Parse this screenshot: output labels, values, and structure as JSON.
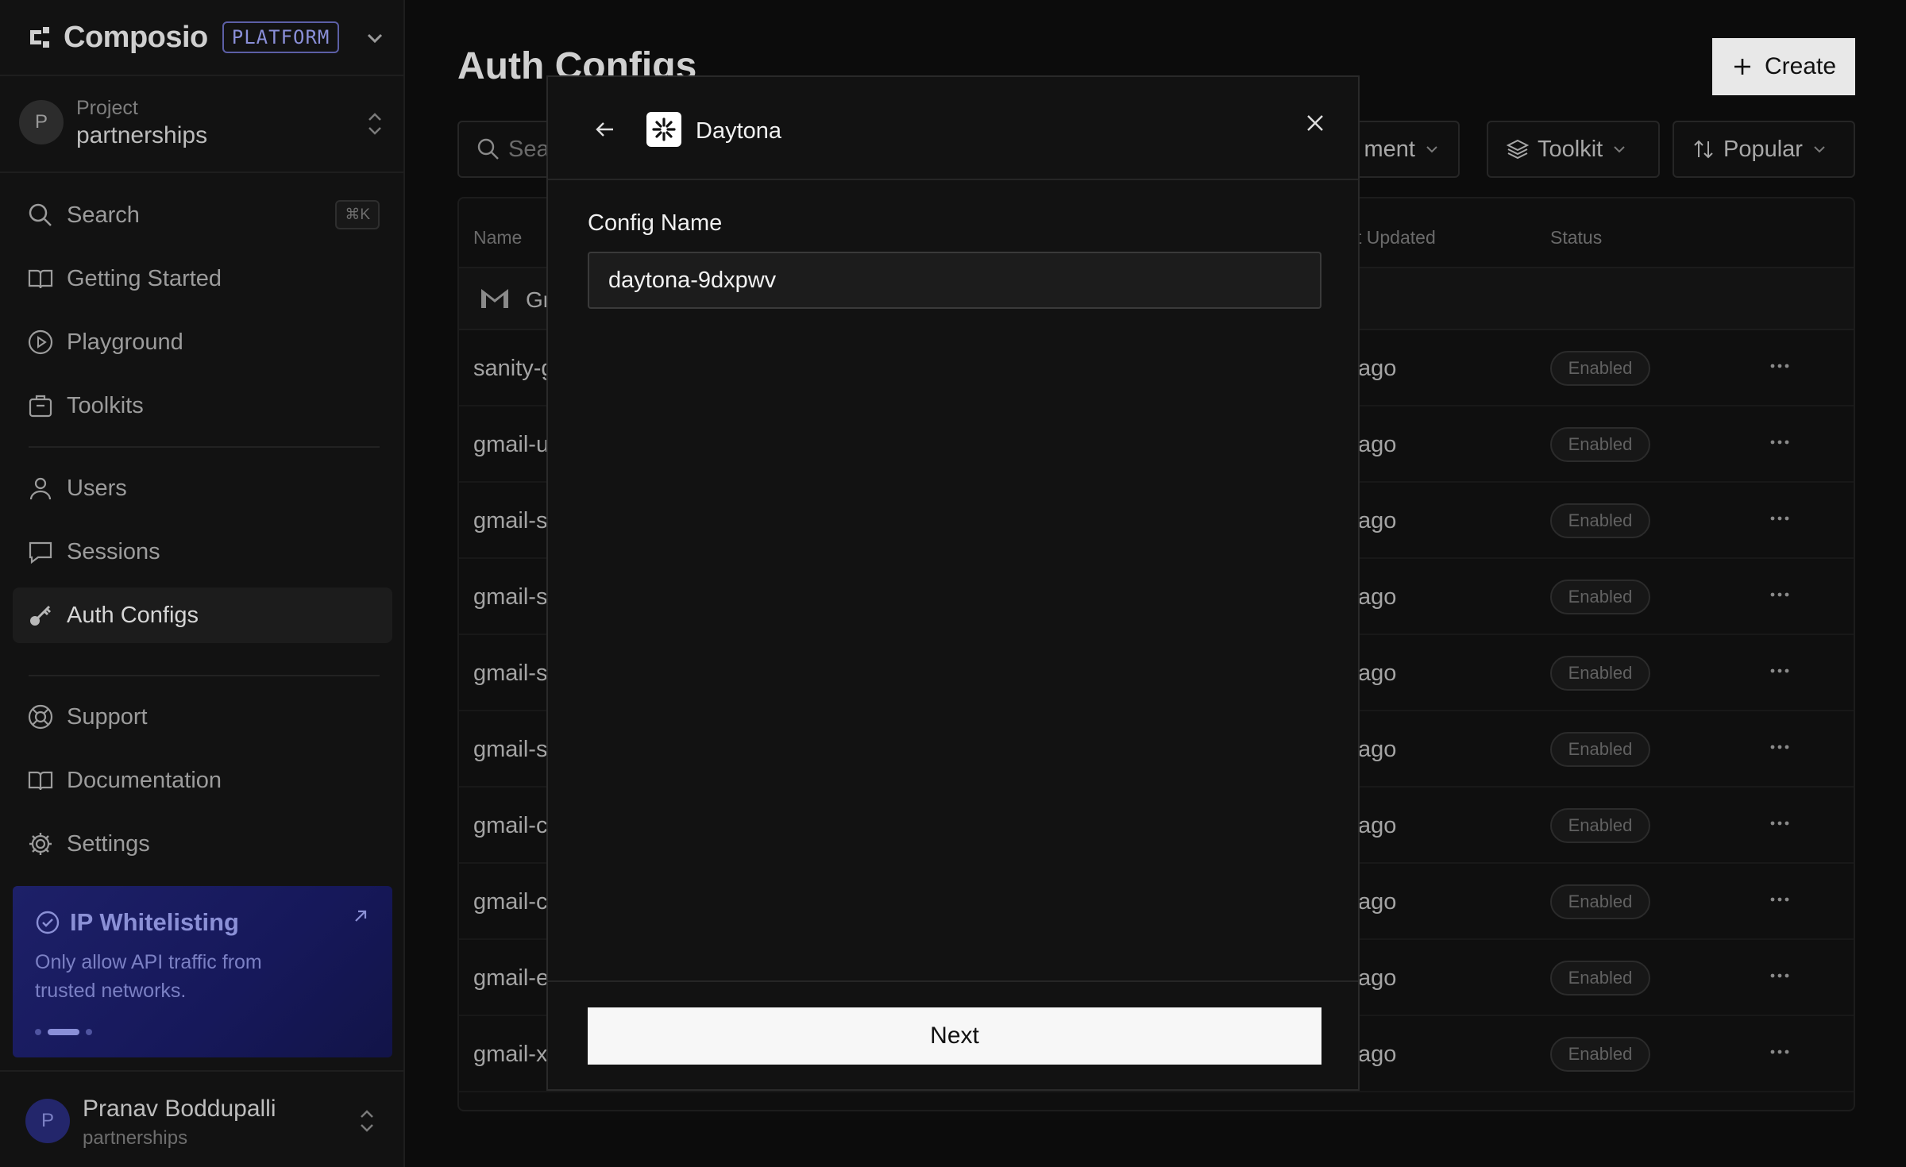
{
  "brand": {
    "name": "Composio",
    "badge": "PLATFORM"
  },
  "project": {
    "label": "Project",
    "name": "partnerships"
  },
  "nav": {
    "search": {
      "label": "Search",
      "shortcut": "⌘K"
    },
    "items": [
      {
        "label": "Getting Started",
        "icon": "book-open-icon"
      },
      {
        "label": "Playground",
        "icon": "play-circle-icon"
      },
      {
        "label": "Toolkits",
        "icon": "toolkit-icon"
      }
    ],
    "items2": [
      {
        "label": "Users",
        "icon": "user-icon"
      },
      {
        "label": "Sessions",
        "icon": "chat-icon"
      },
      {
        "label": "Auth Configs",
        "icon": "key-icon",
        "active": true
      }
    ],
    "bottom": [
      {
        "label": "Support",
        "icon": "lifebuoy-icon"
      },
      {
        "label": "Documentation",
        "icon": "book-icon"
      },
      {
        "label": "Settings",
        "icon": "gear-icon"
      }
    ]
  },
  "promo": {
    "title": "IP Whitelisting",
    "description": "Only allow API traffic from trusted networks."
  },
  "user": {
    "name": "Pranav Boddupalli",
    "project": "partnerships",
    "initial": "P"
  },
  "page": {
    "title": "Auth Configs",
    "create_label": "Create",
    "search_placeholder": "Sea",
    "filters": {
      "environment": "ment",
      "toolkit": "Toolkit",
      "sort": "Popular"
    },
    "columns": {
      "name": "Name",
      "updated": "t Updated",
      "status": "Status"
    },
    "group": {
      "name": "Gr"
    },
    "rows": [
      {
        "name": "sanity-g",
        "updated": "ago",
        "status": "Enabled"
      },
      {
        "name": "gmail-u",
        "updated": "ago",
        "status": "Enabled"
      },
      {
        "name": "gmail-s",
        "updated": "ago",
        "status": "Enabled"
      },
      {
        "name": "gmail-s",
        "updated": "ago",
        "status": "Enabled"
      },
      {
        "name": "gmail-s",
        "updated": "ago",
        "status": "Enabled"
      },
      {
        "name": "gmail-s",
        "updated": "ago",
        "status": "Enabled"
      },
      {
        "name": "gmail-c",
        "updated": "ago",
        "status": "Enabled"
      },
      {
        "name": "gmail-c",
        "updated": "ago",
        "status": "Enabled"
      },
      {
        "name": "gmail-e",
        "updated": "ago",
        "status": "Enabled"
      },
      {
        "name": "gmail-xl",
        "updated": "ago",
        "status": "Enabled"
      }
    ]
  },
  "modal": {
    "app_name": "Daytona",
    "field_label": "Config Name",
    "field_value": "daytona-9dxpwv",
    "next_label": "Next"
  },
  "colors": {
    "accent": "#8a8fd8",
    "promo_bg": "#1d2068",
    "modal_bg": "#121212"
  }
}
